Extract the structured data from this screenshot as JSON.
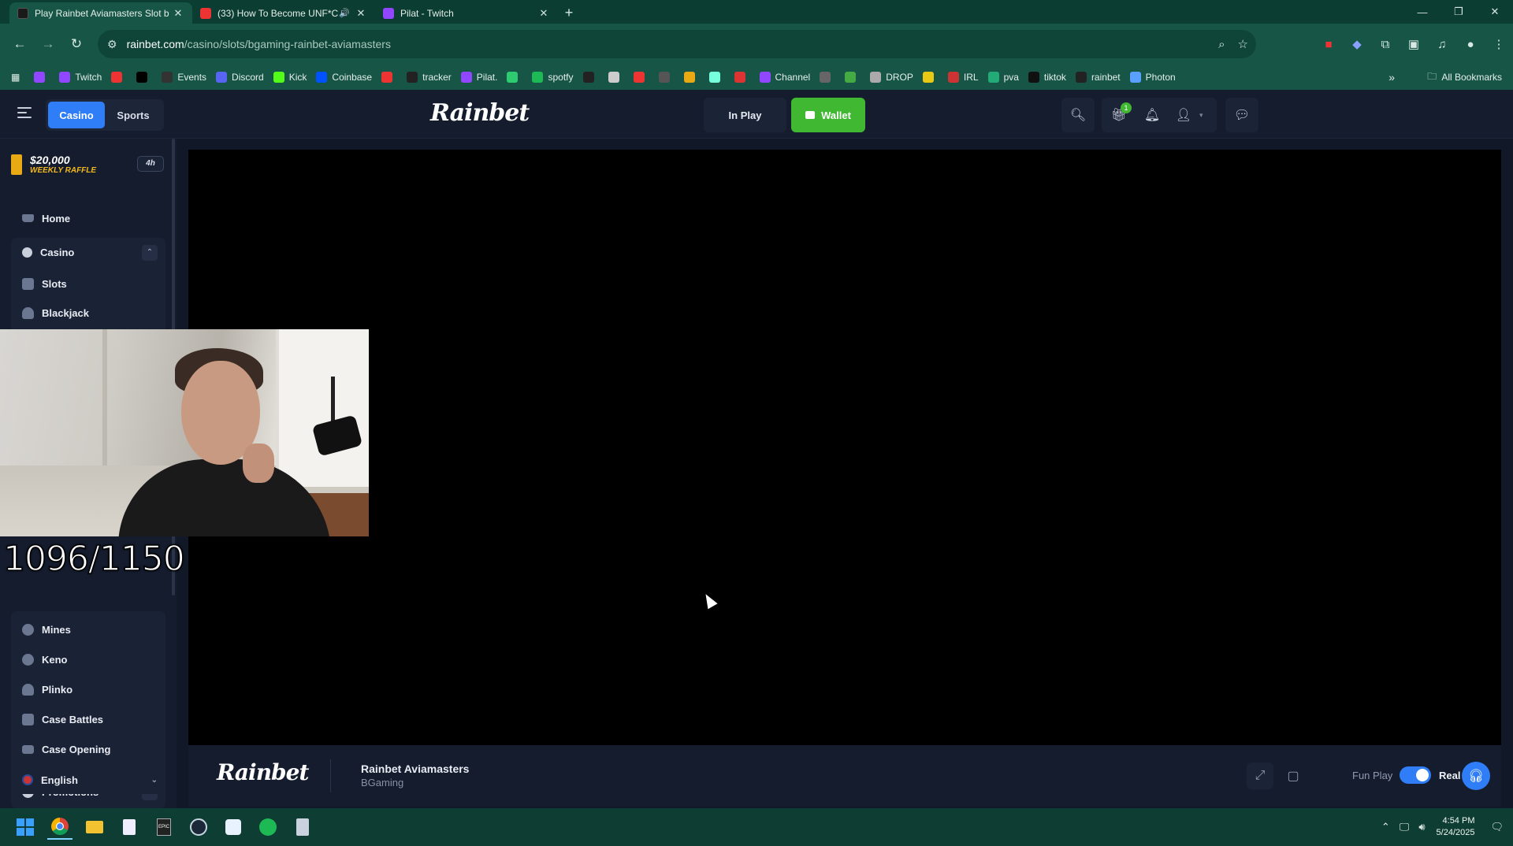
{
  "browser": {
    "tabs": [
      {
        "title": "Play Rainbet Aviamasters Slot b",
        "active": true,
        "favicon_color": "#1a1a1a"
      },
      {
        "title": "(33) How To Become UNF*C",
        "active": false,
        "favicon_color": "#e33"
      },
      {
        "title": "Pilat - Twitch",
        "active": false,
        "favicon_color": "#9146ff"
      }
    ],
    "new_tab_symbol": "+",
    "url_host": "rainbet.com",
    "url_path": "/casino/slots/bgaming-rainbet-aviamasters",
    "bookmarks": [
      {
        "label": "",
        "color": "#9146ff"
      },
      {
        "label": "Twitch",
        "color": "#9146ff"
      },
      {
        "label": "",
        "color": "#e33"
      },
      {
        "label": "",
        "color": "#000"
      },
      {
        "label": "Events",
        "color": "#333"
      },
      {
        "label": "Discord",
        "color": "#5865f2"
      },
      {
        "label": "Kick",
        "color": "#53fc18"
      },
      {
        "label": "Coinbase",
        "color": "#0052ff"
      },
      {
        "label": "",
        "color": "#e33"
      },
      {
        "label": "tracker",
        "color": "#222"
      },
      {
        "label": "Pilat.",
        "color": "#9146ff"
      },
      {
        "label": "",
        "color": "#2ecc71"
      },
      {
        "label": "spotfy",
        "color": "#1db954"
      },
      {
        "label": "",
        "color": "#222"
      },
      {
        "label": "",
        "color": "#ccc"
      },
      {
        "label": "",
        "color": "#e33"
      },
      {
        "label": "",
        "color": "#555"
      },
      {
        "label": "",
        "color": "#e8a915"
      },
      {
        "label": "",
        "color": "#7fd"
      },
      {
        "label": "",
        "color": "#d33"
      },
      {
        "label": "Channel",
        "color": "#9146ff"
      },
      {
        "label": "",
        "color": "#666"
      },
      {
        "label": "",
        "color": "#4a4"
      },
      {
        "label": "DROP",
        "color": "#aaa"
      },
      {
        "label": "",
        "color": "#e8c915"
      },
      {
        "label": "IRL",
        "color": "#c33"
      },
      {
        "label": "pva",
        "color": "#2a7"
      },
      {
        "label": "tiktok",
        "color": "#111"
      },
      {
        "label": "rainbet",
        "color": "#222"
      },
      {
        "label": "Photon",
        "color": "#5aa0ff"
      }
    ],
    "all_bookmarks": "All Bookmarks"
  },
  "site": {
    "logo": "Rainbet",
    "segment": {
      "casino": "Casino",
      "sports": "Sports"
    },
    "in_play": "In Play",
    "wallet": "Wallet",
    "gift_badge": "1",
    "raffle": {
      "amount": "$20,000",
      "label": "WEEKLY RAFFLE",
      "timer": "4h"
    },
    "sidebar": {
      "home": "Home",
      "casino": "Casino",
      "slots": "Slots",
      "blackjack": "Blackjack",
      "mines": "Mines",
      "keno": "Keno",
      "plinko": "Plinko",
      "case_battles": "Case Battles",
      "case_opening": "Case Opening",
      "promotions": "Promotions",
      "language": "English"
    },
    "game": {
      "title": "Rainbet Aviamasters",
      "provider": "BGaming",
      "fun_play": "Fun Play",
      "real_play": "Real P",
      "real_mode_on": true
    }
  },
  "overlay": {
    "counter": "1096/1150"
  },
  "taskbar": {
    "time": "4:54 PM",
    "date": "5/24/2025"
  },
  "colors": {
    "accent_blue": "#2f7ef7",
    "wallet_green": "#40b832",
    "raffle_gold": "#f2b81d",
    "browser_green": "#175547"
  }
}
